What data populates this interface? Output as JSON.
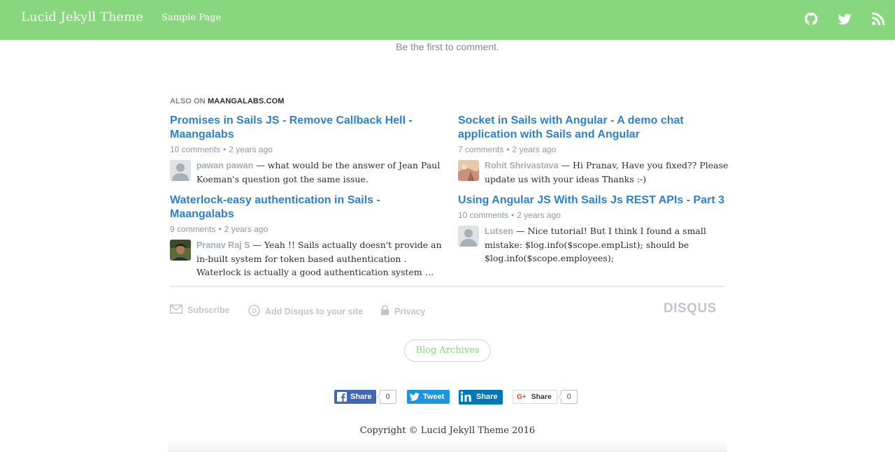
{
  "navbar": {
    "brand": "Lucid Jekyll Theme",
    "links": [
      "Sample Page"
    ],
    "icons": [
      "github-icon",
      "twitter-icon",
      "rss-icon"
    ],
    "background_color": "#88d67d"
  },
  "comments": {
    "empty_text": "Be the first to comment."
  },
  "also_on": {
    "prefix": "ALSO ON",
    "site": "MAANGALABS.COM",
    "items": [
      {
        "title": "Promises in Sails JS - Remove Callback Hell - Maangalabs",
        "comments": "10 comments",
        "age": "2 years ago",
        "author": "pawan pawan",
        "excerpt": "what would be the answer of Jean Paul Koeman's question got the same issue.",
        "avatar": "default-avatar"
      },
      {
        "title": "Socket in Sails with Angular - A demo chat application with Sails and Angular",
        "comments": "7 comments",
        "age": "2 years ago",
        "author": "Rohit Shrivastava",
        "excerpt": "Hi Pranav, Have you fixed?? Please update us with your ideas Thanks :-)",
        "avatar": "photo-avatar"
      },
      {
        "title": "Waterlock-easy authentication in Sails - Maangalabs",
        "comments": "9 comments",
        "age": "2 years ago",
        "author": "Pranav Raj S",
        "excerpt": "Yeah !! Sails actually doesn't provide an in-built system for token based authentication . Waterlock is actually a good authentication system …",
        "avatar": "photo-avatar"
      },
      {
        "title": "Using Angular JS With Sails Js REST APIs - Part 3",
        "comments": "10 comments",
        "age": "2 years ago",
        "author": "Lutsen",
        "excerpt": "Nice tutorial! But I think I found a small mistake: $log.info($scope.empList); should be $log.info($scope.employees);",
        "avatar": "default-avatar"
      }
    ]
  },
  "disqus_footer": {
    "subscribe": "Subscribe",
    "add_disqus": "Add Disqus to your site",
    "privacy": "Privacy",
    "logo": "DISQUS"
  },
  "archives_button": "Blog Archives",
  "share_buttons": {
    "facebook": {
      "label": "Share",
      "count": "0",
      "color": "#4267b2"
    },
    "twitter": {
      "label": "Tweet",
      "color": "#1b95e0"
    },
    "linkedin": {
      "label": "Share",
      "color": "#0077b5"
    },
    "google": {
      "label": "Share",
      "count": "0"
    }
  },
  "footer": {
    "copyright": "Copyright © Lucid Jekyll Theme 2016"
  }
}
